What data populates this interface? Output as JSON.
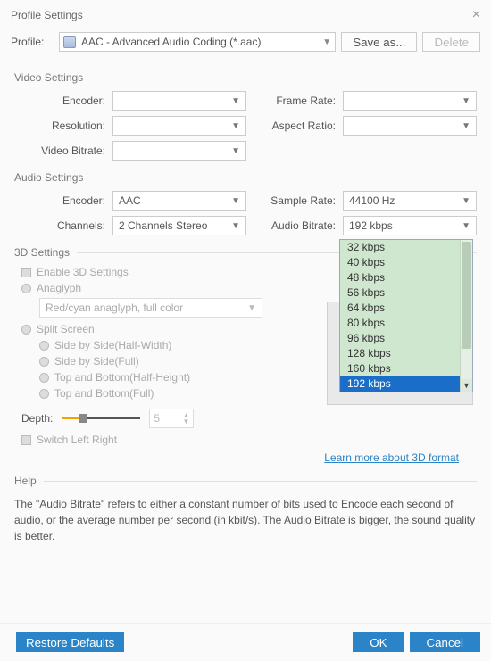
{
  "window": {
    "title": "Profile Settings"
  },
  "profile": {
    "label": "Profile:",
    "selected": "AAC - Advanced Audio Coding (*.aac)",
    "save_as": "Save as...",
    "delete": "Delete"
  },
  "video": {
    "title": "Video Settings",
    "encoder_label": "Encoder:",
    "resolution_label": "Resolution:",
    "bitrate_label": "Video Bitrate:",
    "framerate_label": "Frame Rate:",
    "aspect_label": "Aspect Ratio:",
    "encoder": "",
    "resolution": "",
    "bitrate": "",
    "framerate": "",
    "aspect": ""
  },
  "audio": {
    "title": "Audio Settings",
    "encoder_label": "Encoder:",
    "channels_label": "Channels:",
    "samplerate_label": "Sample Rate:",
    "bitrate_label": "Audio Bitrate:",
    "encoder": "AAC",
    "channels": "2 Channels Stereo",
    "samplerate": "44100 Hz",
    "bitrate": "192 kbps",
    "bitrate_options": [
      "32 kbps",
      "40 kbps",
      "48 kbps",
      "56 kbps",
      "64 kbps",
      "80 kbps",
      "96 kbps",
      "128 kbps",
      "160 kbps",
      "192 kbps"
    ]
  },
  "three_d": {
    "title": "3D Settings",
    "enable": "Enable 3D Settings",
    "anaglyph": "Anaglyph",
    "anaglyph_mode": "Red/cyan anaglyph, full color",
    "split": "Split Screen",
    "sbs_half": "Side by Side(Half-Width)",
    "sbs_full": "Side by Side(Full)",
    "tb_half": "Top and Bottom(Half-Height)",
    "tb_full": "Top and Bottom(Full)",
    "depth_label": "Depth:",
    "depth_value": "5",
    "switch_lr": "Switch Left Right",
    "learn_more": "Learn more about 3D format"
  },
  "help": {
    "title": "Help",
    "text": "The \"Audio Bitrate\" refers to either a constant number of bits used to Encode each second of audio, or the average number per second (in kbit/s). The Audio Bitrate is bigger, the sound quality is better."
  },
  "footer": {
    "restore": "Restore Defaults",
    "ok": "OK",
    "cancel": "Cancel"
  }
}
